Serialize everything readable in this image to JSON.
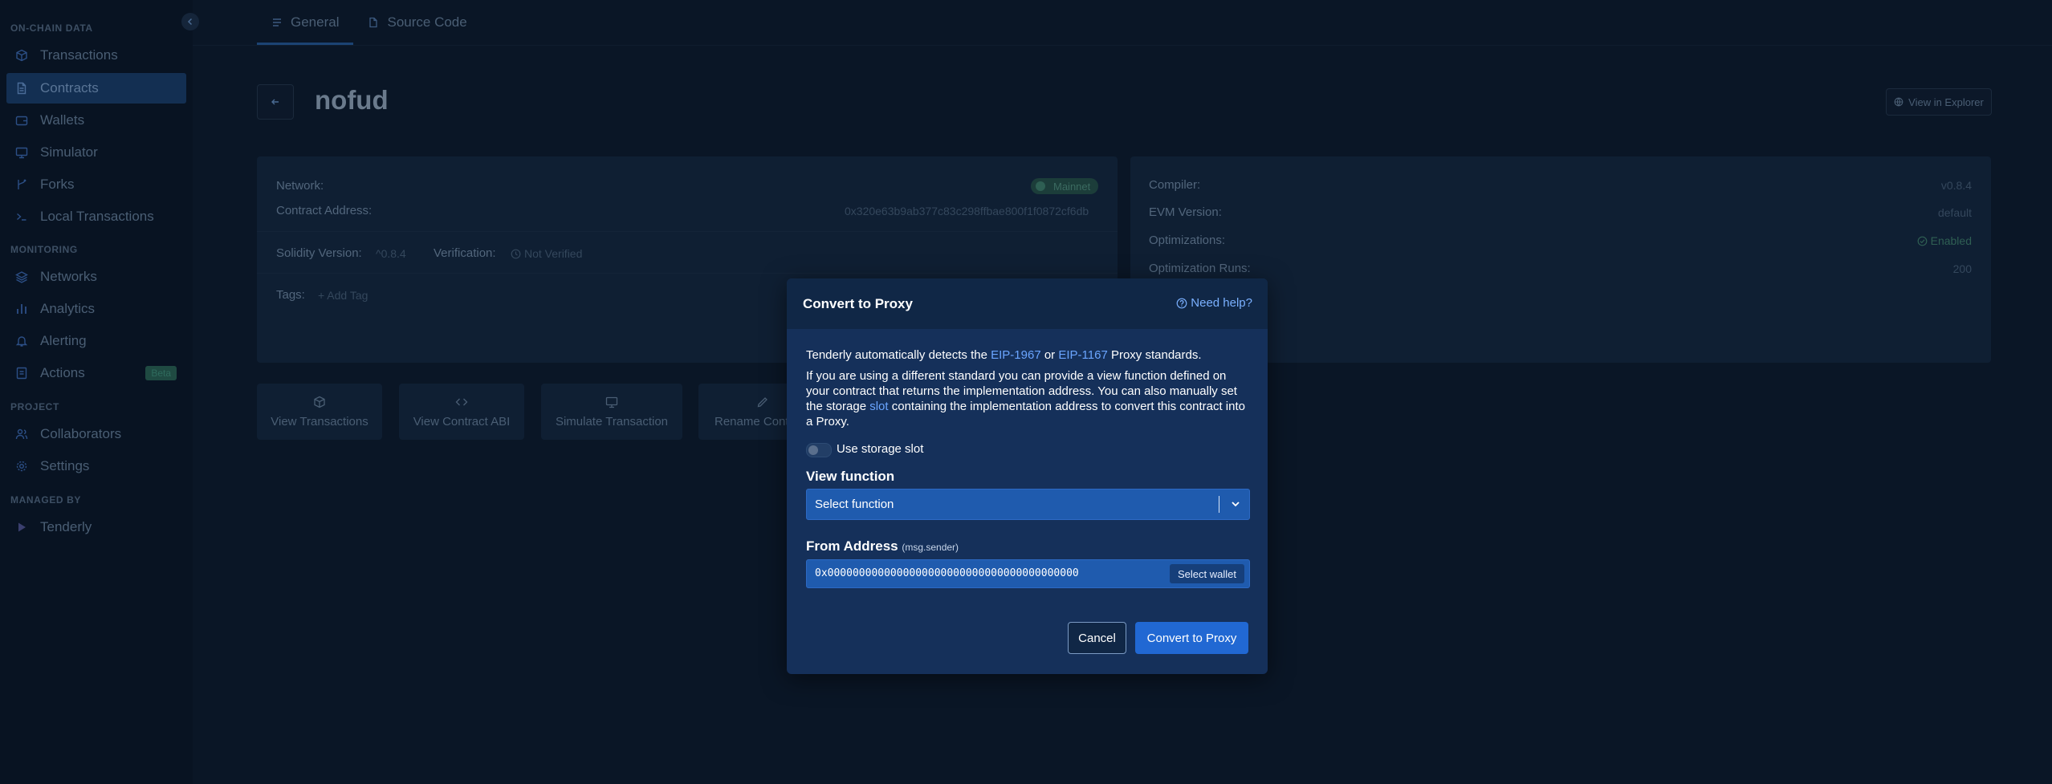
{
  "sidebar": {
    "sections": {
      "onchain": "ON-CHAIN DATA",
      "monitoring": "MONITORING",
      "project": "PROJECT",
      "managed_by": "MANAGED BY"
    },
    "items": {
      "transactions": "Transactions",
      "contracts": "Contracts",
      "wallets": "Wallets",
      "simulator": "Simulator",
      "forks": "Forks",
      "local_transactions": "Local Transactions",
      "networks": "Networks",
      "analytics": "Analytics",
      "alerting": "Alerting",
      "actions": "Actions",
      "actions_badge": "Beta",
      "collaborators": "Collaborators",
      "settings": "Settings",
      "tenderly": "Tenderly"
    },
    "active_item": "Contracts"
  },
  "tabs": {
    "general": "General",
    "source_code": "Source Code"
  },
  "header": {
    "title": "nofud",
    "view_in_explorer": "View in Explorer"
  },
  "overview": {
    "network_label": "Network:",
    "network_value": "Mainnet",
    "address_label": "Contract Address:",
    "address_value": "0x320e63b9ab377c83c298ffbae800f1f0872cf6db",
    "solidity_label": "Solidity Version:",
    "solidity_value": "^0.8.4",
    "verification_label": "Verification:",
    "verification_value": "Not Verified",
    "tags_label": "Tags:",
    "add_tag": "+ Add Tag"
  },
  "compiler": {
    "compiler_label": "Compiler:",
    "compiler_value": "v0.8.4",
    "evm_label": "EVM Version:",
    "evm_value": "default",
    "optimizations_label": "Optimizations:",
    "optimizations_value": "Enabled",
    "runs_label": "Optimization Runs:",
    "runs_value": "200"
  },
  "actions": {
    "view_transactions": "View Transactions",
    "view_abi": "View Contract ABI",
    "simulate": "Simulate Transaction",
    "rename": "Rename Cont"
  },
  "modal": {
    "title": "Convert to Proxy",
    "help": "Need help?",
    "intro_prefix": "Tenderly automatically detects the ",
    "eip1967": "EIP-1967",
    "intro_or": " or ",
    "eip1167": "EIP-1167",
    "intro_suffix": " Proxy standards.",
    "desc_prefix": "If you are using a different standard you can provide a view function defined on your contract that returns the implementation address. You can also manually set the storage ",
    "desc_slot": "slot",
    "desc_suffix": " containing the implementation address to convert this contract into a Proxy.",
    "use_storage_slot": "Use storage slot",
    "view_function_label": "View function",
    "select_placeholder": "Select function",
    "from_address_label": "From Address",
    "from_address_hint": "(msg.sender)",
    "from_address_value": "0x0000000000000000000000000000000000000000",
    "select_wallet": "Select wallet",
    "cancel": "Cancel",
    "convert": "Convert to Proxy"
  },
  "colors": {
    "background": "#0a1626",
    "modal": "#15305a",
    "primary": "#2168d3",
    "link": "#6aa5ff"
  }
}
